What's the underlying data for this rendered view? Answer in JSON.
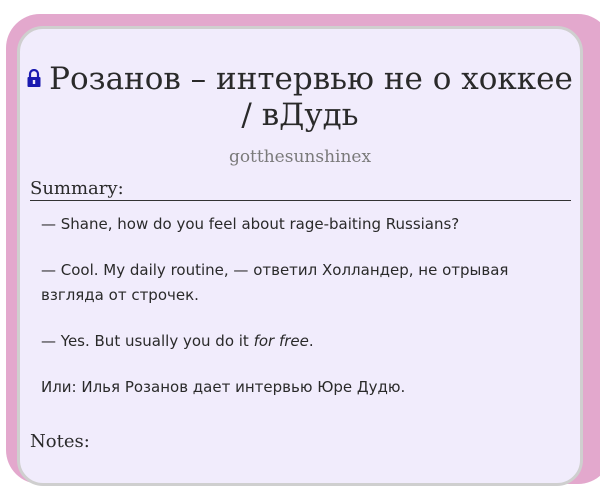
{
  "work": {
    "title": "Розанов – интервью не о хоккее / вДудь",
    "author": "gotthesunshinex",
    "lock_icon": "lock-icon",
    "colors": {
      "frame": "#e3a8cd",
      "card": "#f1ecfc",
      "lock": "#1a1ab0"
    }
  },
  "summary": {
    "heading": "Summary:",
    "p1": "— Shane, how do you feel about rage-baiting Russians?",
    "p2": "— Cool. My daily routine, — ответил Холландер, не отрывая взгляда от строчек.",
    "p3_text": "— Yes. But usually you do it ",
    "p3_emph": "for free",
    "p3_end": ".",
    "p4": "Или: Илья Розанов дает интервью Юре Дудю."
  },
  "notes": {
    "heading": "Notes:"
  }
}
